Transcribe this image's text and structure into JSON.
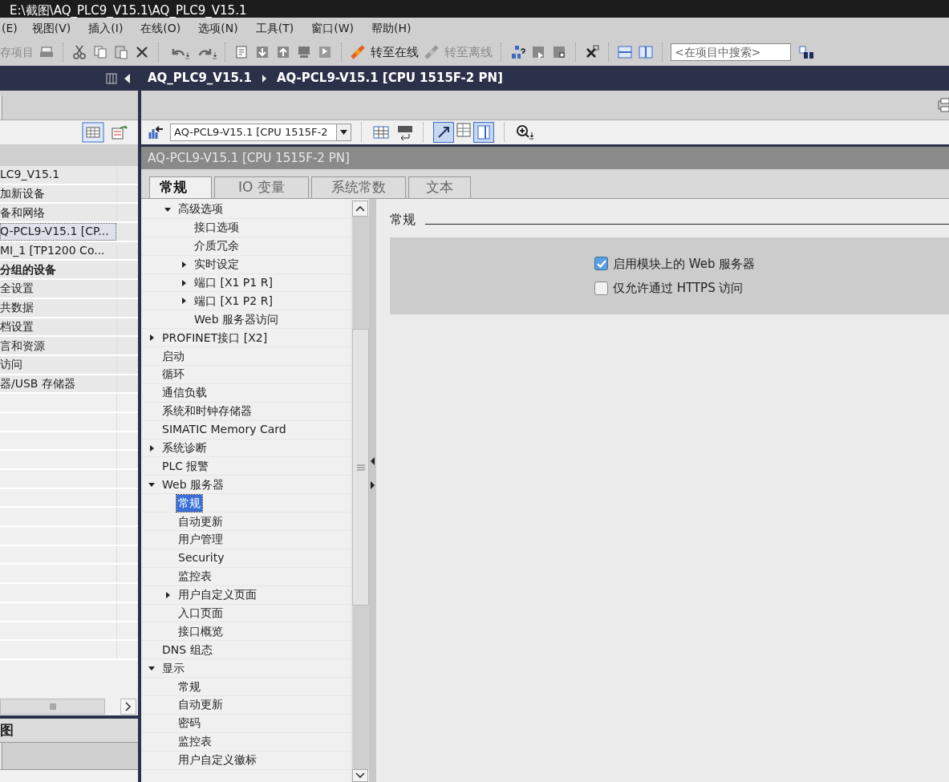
{
  "title_bar": {
    "title": "E:\\截图\\AQ_PLC9_V15.1\\AQ_PLC9_V15.1"
  },
  "menu": [
    "(E)",
    "视图(V)",
    "插入(I)",
    "在线(O)",
    "选项(N)",
    "工具(T)",
    "窗口(W)",
    "帮助(H)"
  ],
  "toolbar": {
    "save": {
      "label": "存项目",
      "disabled": true
    },
    "go_online": {
      "label": "转至在线",
      "disabled": false
    },
    "go_offline": {
      "label": "转至离线",
      "disabled": true
    },
    "search": {
      "placeholder": "<在项目中搜索>"
    }
  },
  "breadcrumb": [
    "AQ_PLC9_V15.1",
    "AQ-PCL9-V15.1 [CPU 1515F-2 PN]"
  ],
  "project_tree": {
    "items": [
      {
        "label": "LC9_V15.1",
        "selected": false,
        "bold": false
      },
      {
        "label": "加新设备",
        "selected": false,
        "bold": false
      },
      {
        "label": "备和网络",
        "selected": false,
        "bold": false
      },
      {
        "label": "Q-PCL9-V15.1 [CP...",
        "selected": true,
        "bold": false
      },
      {
        "label": "MI_1 [TP1200 Co...",
        "selected": false,
        "bold": false
      },
      {
        "label": "分组的设备",
        "selected": false,
        "bold": true
      },
      {
        "label": "全设置",
        "selected": false,
        "bold": false
      },
      {
        "label": "共数据",
        "selected": false,
        "bold": false
      },
      {
        "label": "档设置",
        "selected": false,
        "bold": false
      },
      {
        "label": "言和资源",
        "selected": false,
        "bold": false
      },
      {
        "label": "访问",
        "selected": false,
        "bold": false
      },
      {
        "label": "器/USB 存储器",
        "selected": false,
        "bold": false
      }
    ]
  },
  "details_view": {
    "title": "图"
  },
  "device_selector": {
    "value": "AQ-PCL9-V15.1 [CPU 1515F-2"
  },
  "inspector": {
    "title": "AQ-PCL9-V15.1 [CPU 1515F-2 PN]",
    "tabs": [
      {
        "label": "常规",
        "selected": true
      },
      {
        "label": "IO 变量",
        "selected": false
      },
      {
        "label": "系统常数",
        "selected": false
      },
      {
        "label": "文本",
        "selected": false
      }
    ],
    "tree": {
      "partial_branch": [
        {
          "label": "高级选项",
          "expanded": true,
          "children": [
            {
              "label": "接口选项",
              "selected": false
            },
            {
              "label": "介质冗余",
              "selected": false
            },
            {
              "label": "实时设定",
              "expanded": false,
              "selected": false
            },
            {
              "label": "端口 [X1 P1 R]",
              "expanded": false,
              "selected": false
            },
            {
              "label": "端口 [X1 P2 R]",
              "expanded": false,
              "selected": false
            },
            {
              "label": "Web 服务器访问",
              "selected": false
            }
          ]
        }
      ],
      "items": [
        {
          "label": "PROFINET接口 [X2]",
          "expanded": false,
          "selected": false
        },
        {
          "label": "启动",
          "selected": false
        },
        {
          "label": "循环",
          "selected": false
        },
        {
          "label": "通信负载",
          "selected": false
        },
        {
          "label": "系统和时钟存储器",
          "selected": false
        },
        {
          "label": "SIMATIC Memory Card",
          "selected": false
        },
        {
          "label": "系统诊断",
          "expanded": false,
          "selected": false
        },
        {
          "label": "PLC 报警",
          "selected": false
        },
        {
          "label": "Web 服务器",
          "expanded": true,
          "selected": false,
          "children": [
            {
              "label": "常规",
              "selected": true
            },
            {
              "label": "自动更新",
              "selected": false
            },
            {
              "label": "用户管理",
              "selected": false
            },
            {
              "label": "Security",
              "selected": false
            },
            {
              "label": "监控表",
              "selected": false
            },
            {
              "label": "用户自定义页面",
              "expanded": false,
              "selected": false
            },
            {
              "label": "入口页面",
              "selected": false
            },
            {
              "label": "接口概览",
              "selected": false
            }
          ]
        },
        {
          "label": "DNS 组态",
          "selected": false
        },
        {
          "label": "显示",
          "expanded": true,
          "selected": false,
          "children": [
            {
              "label": "常规",
              "selected": false
            },
            {
              "label": "自动更新",
              "selected": false
            },
            {
              "label": "密码",
              "selected": false
            },
            {
              "label": "监控表",
              "selected": false
            },
            {
              "label": "用户自定义徽标",
              "selected": false
            }
          ]
        }
      ]
    },
    "section": {
      "title": "常规",
      "options": [
        {
          "label": "启用模块上的 Web 服务器",
          "checked": true
        },
        {
          "label": "仅允许通过 HTTPS 访问",
          "checked": false
        }
      ]
    }
  }
}
